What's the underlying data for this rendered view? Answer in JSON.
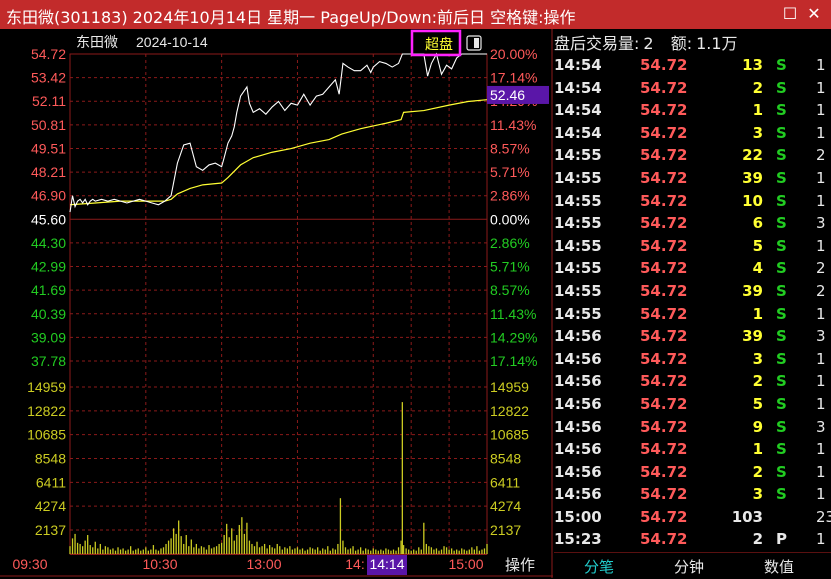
{
  "window": {
    "title": "东田微(301183) 2024年10月14日 星期一 PageUp/Down:前后日 空格键:操作",
    "restore_icon": "restore-icon",
    "close_icon": "close-icon"
  },
  "chart_header": {
    "stock_name": "东田微",
    "date": "2024-10-14",
    "super_button": "超盘",
    "toggle_icon": "panel-toggle-icon"
  },
  "price_axis": {
    "left_labels": [
      "54.72",
      "53.42",
      "52.11",
      "50.81",
      "49.51",
      "48.21",
      "46.90",
      "45.60",
      "44.30",
      "42.99",
      "41.69",
      "40.39",
      "39.09",
      "37.78"
    ],
    "right_labels": [
      "20.00%",
      "17.14%",
      "14.29%",
      "11.43%",
      "8.57%",
      "5.71%",
      "2.86%",
      "0.00%",
      "2.86%",
      "5.71%",
      "8.57%",
      "11.43%",
      "14.29%",
      "17.14%"
    ],
    "cursor_price": "52.46",
    "min": 37.78,
    "max": 54.72,
    "prev_close": 45.6
  },
  "volume_axis": {
    "labels": [
      "14959",
      "12822",
      "10685",
      "8548",
      "6411",
      "4274",
      "2137"
    ],
    "max": 14959
  },
  "time_axis": {
    "labels": [
      "09:30",
      "10:30",
      "13:00",
      "14:",
      "15:00"
    ],
    "cursor_time": "14:14",
    "operate_label": "操作"
  },
  "colors": {
    "up": "#ff5a5a",
    "down": "#22cc22",
    "price_line": "#ffffff",
    "avg_line": "#ffff33",
    "volume": "#cccc22",
    "grid": "#8b1a1a",
    "cursor_bg": "#5a16a8",
    "highlight_border": "#ff22ff"
  },
  "chart_data": {
    "type": "line",
    "x_range": [
      "09:30",
      "15:00"
    ],
    "price": [
      [
        0,
        46.0
      ],
      [
        2,
        46.9
      ],
      [
        4,
        46.3
      ],
      [
        6,
        46.6
      ],
      [
        8,
        46.7
      ],
      [
        10,
        46.5
      ],
      [
        12,
        46.7
      ],
      [
        14,
        46.4
      ],
      [
        16,
        46.6
      ],
      [
        18,
        46.7
      ],
      [
        20,
        46.6
      ],
      [
        25,
        46.7
      ],
      [
        30,
        46.6
      ],
      [
        35,
        46.7
      ],
      [
        40,
        46.6
      ],
      [
        45,
        46.5
      ],
      [
        50,
        46.6
      ],
      [
        55,
        46.7
      ],
      [
        60,
        46.6
      ],
      [
        65,
        46.5
      ],
      [
        70,
        46.4
      ],
      [
        75,
        46.6
      ],
      [
        80,
        46.9
      ],
      [
        85,
        48.7
      ],
      [
        90,
        49.7
      ],
      [
        95,
        49.8
      ],
      [
        100,
        48.5
      ],
      [
        105,
        48.3
      ],
      [
        110,
        48.6
      ],
      [
        115,
        48.7
      ],
      [
        120,
        48.5
      ],
      [
        122,
        49.0
      ],
      [
        125,
        49.8
      ],
      [
        128,
        50.2
      ],
      [
        130,
        50.7
      ],
      [
        132,
        51.5
      ],
      [
        135,
        52.4
      ],
      [
        137,
        52.6
      ],
      [
        140,
        52.9
      ],
      [
        142,
        52.0
      ],
      [
        145,
        51.5
      ],
      [
        150,
        51.7
      ],
      [
        155,
        51.4
      ],
      [
        160,
        51.8
      ],
      [
        165,
        52.1
      ],
      [
        170,
        51.6
      ],
      [
        175,
        52.0
      ],
      [
        180,
        51.9
      ],
      [
        185,
        52.5
      ],
      [
        190,
        51.9
      ],
      [
        195,
        52.4
      ],
      [
        200,
        52.5
      ],
      [
        205,
        52.9
      ],
      [
        210,
        53.3
      ],
      [
        213,
        52.5
      ],
      [
        216,
        54.2
      ],
      [
        220,
        54.0
      ],
      [
        225,
        53.8
      ],
      [
        230,
        53.8
      ],
      [
        235,
        54.1
      ],
      [
        238,
        53.7
      ],
      [
        240,
        54.0
      ],
      [
        245,
        54.3
      ],
      [
        250,
        54.2
      ],
      [
        255,
        54.0
      ],
      [
        260,
        54.2
      ],
      [
        263,
        54.72
      ],
      [
        270,
        54.72
      ],
      [
        275,
        54.72
      ],
      [
        280,
        54.72
      ],
      [
        283,
        53.5
      ],
      [
        286,
        54.2
      ],
      [
        290,
        54.72
      ],
      [
        294,
        53.6
      ],
      [
        298,
        54.1
      ],
      [
        302,
        53.9
      ],
      [
        306,
        54.5
      ],
      [
        310,
        54.72
      ],
      [
        330,
        54.72
      ]
    ],
    "average": [
      [
        0,
        46.4
      ],
      [
        20,
        46.5
      ],
      [
        40,
        46.6
      ],
      [
        60,
        46.6
      ],
      [
        75,
        46.6
      ],
      [
        80,
        46.7
      ],
      [
        85,
        47.0
      ],
      [
        95,
        47.3
      ],
      [
        105,
        47.5
      ],
      [
        120,
        47.6
      ],
      [
        125,
        47.9
      ],
      [
        135,
        48.6
      ],
      [
        145,
        49.0
      ],
      [
        160,
        49.3
      ],
      [
        175,
        49.5
      ],
      [
        190,
        49.8
      ],
      [
        205,
        50.0
      ],
      [
        215,
        50.3
      ],
      [
        230,
        50.6
      ],
      [
        250,
        50.9
      ],
      [
        262,
        51.1
      ],
      [
        264,
        51.5
      ],
      [
        280,
        51.6
      ],
      [
        300,
        51.9
      ],
      [
        315,
        52.1
      ],
      [
        330,
        52.2
      ]
    ],
    "volume": [
      [
        0,
        700
      ],
      [
        2,
        1400
      ],
      [
        4,
        1800
      ],
      [
        6,
        1000
      ],
      [
        8,
        900
      ],
      [
        10,
        700
      ],
      [
        12,
        1200
      ],
      [
        14,
        1700
      ],
      [
        16,
        800
      ],
      [
        18,
        600
      ],
      [
        20,
        1100
      ],
      [
        22,
        500
      ],
      [
        24,
        900
      ],
      [
        26,
        400
      ],
      [
        28,
        700
      ],
      [
        30,
        600
      ],
      [
        32,
        400
      ],
      [
        34,
        500
      ],
      [
        36,
        300
      ],
      [
        38,
        600
      ],
      [
        40,
        400
      ],
      [
        42,
        500
      ],
      [
        44,
        300
      ],
      [
        46,
        400
      ],
      [
        48,
        700
      ],
      [
        50,
        300
      ],
      [
        52,
        400
      ],
      [
        54,
        500
      ],
      [
        56,
        300
      ],
      [
        58,
        400
      ],
      [
        60,
        600
      ],
      [
        62,
        300
      ],
      [
        64,
        400
      ],
      [
        66,
        800
      ],
      [
        68,
        400
      ],
      [
        70,
        300
      ],
      [
        72,
        500
      ],
      [
        74,
        600
      ],
      [
        76,
        900
      ],
      [
        78,
        1200
      ],
      [
        80,
        1400
      ],
      [
        82,
        2300
      ],
      [
        84,
        1800
      ],
      [
        86,
        3000
      ],
      [
        88,
        1600
      ],
      [
        90,
        900
      ],
      [
        92,
        1700
      ],
      [
        94,
        700
      ],
      [
        96,
        1300
      ],
      [
        98,
        600
      ],
      [
        100,
        900
      ],
      [
        102,
        500
      ],
      [
        104,
        700
      ],
      [
        106,
        600
      ],
      [
        108,
        400
      ],
      [
        110,
        800
      ],
      [
        112,
        500
      ],
      [
        114,
        600
      ],
      [
        116,
        700
      ],
      [
        118,
        900
      ],
      [
        120,
        1000
      ],
      [
        122,
        1700
      ],
      [
        124,
        2700
      ],
      [
        126,
        1500
      ],
      [
        128,
        2300
      ],
      [
        130,
        1200
      ],
      [
        132,
        1700
      ],
      [
        134,
        2600
      ],
      [
        136,
        3300
      ],
      [
        138,
        1800
      ],
      [
        140,
        2800
      ],
      [
        142,
        1200
      ],
      [
        144,
        900
      ],
      [
        146,
        700
      ],
      [
        148,
        1100
      ],
      [
        150,
        600
      ],
      [
        152,
        700
      ],
      [
        154,
        900
      ],
      [
        156,
        500
      ],
      [
        158,
        800
      ],
      [
        160,
        600
      ],
      [
        162,
        500
      ],
      [
        164,
        900
      ],
      [
        166,
        700
      ],
      [
        168,
        400
      ],
      [
        170,
        600
      ],
      [
        172,
        500
      ],
      [
        174,
        700
      ],
      [
        176,
        400
      ],
      [
        178,
        500
      ],
      [
        180,
        600
      ],
      [
        182,
        400
      ],
      [
        184,
        500
      ],
      [
        186,
        300
      ],
      [
        188,
        400
      ],
      [
        190,
        600
      ],
      [
        192,
        500
      ],
      [
        194,
        400
      ],
      [
        196,
        600
      ],
      [
        198,
        300
      ],
      [
        200,
        500
      ],
      [
        202,
        400
      ],
      [
        204,
        700
      ],
      [
        206,
        300
      ],
      [
        208,
        500
      ],
      [
        210,
        400
      ],
      [
        212,
        900
      ],
      [
        214,
        5000
      ],
      [
        216,
        1200
      ],
      [
        218,
        600
      ],
      [
        220,
        400
      ],
      [
        222,
        500
      ],
      [
        224,
        700
      ],
      [
        226,
        300
      ],
      [
        228,
        400
      ],
      [
        230,
        600
      ],
      [
        232,
        300
      ],
      [
        234,
        500
      ],
      [
        236,
        400
      ],
      [
        238,
        300
      ],
      [
        240,
        500
      ],
      [
        242,
        400
      ],
      [
        244,
        300
      ],
      [
        246,
        400
      ],
      [
        248,
        300
      ],
      [
        250,
        500
      ],
      [
        252,
        400
      ],
      [
        254,
        300
      ],
      [
        256,
        400
      ],
      [
        258,
        300
      ],
      [
        260,
        600
      ],
      [
        262,
        1200
      ],
      [
        263,
        13600
      ],
      [
        264,
        800
      ],
      [
        266,
        500
      ],
      [
        268,
        400
      ],
      [
        270,
        300
      ],
      [
        272,
        400
      ],
      [
        274,
        300
      ],
      [
        276,
        600
      ],
      [
        278,
        400
      ],
      [
        280,
        2800
      ],
      [
        282,
        900
      ],
      [
        284,
        700
      ],
      [
        286,
        600
      ],
      [
        288,
        400
      ],
      [
        290,
        500
      ],
      [
        292,
        300
      ],
      [
        294,
        400
      ],
      [
        296,
        700
      ],
      [
        298,
        600
      ],
      [
        300,
        400
      ],
      [
        302,
        500
      ],
      [
        304,
        300
      ],
      [
        306,
        400
      ],
      [
        308,
        300
      ],
      [
        310,
        500
      ],
      [
        312,
        400
      ],
      [
        314,
        300
      ],
      [
        316,
        400
      ],
      [
        318,
        600
      ],
      [
        320,
        400
      ],
      [
        322,
        700
      ],
      [
        324,
        300
      ],
      [
        326,
        400
      ],
      [
        328,
        500
      ],
      [
        330,
        900
      ]
    ]
  },
  "trade_panel": {
    "header": {
      "volume_label": "盘后交易量:",
      "volume_value": "2",
      "amount_label": "额:",
      "amount_value": "1.1万"
    },
    "rows": [
      {
        "time": "14:54",
        "price": "54.72",
        "volume": "13",
        "bs": "S",
        "n": "1",
        "bs_color": "#22cc22",
        "vol_color": "#ffff33"
      },
      {
        "time": "14:54",
        "price": "54.72",
        "volume": "2",
        "bs": "S",
        "n": "1",
        "bs_color": "#22cc22",
        "vol_color": "#ffff33"
      },
      {
        "time": "14:54",
        "price": "54.72",
        "volume": "1",
        "bs": "S",
        "n": "1",
        "bs_color": "#22cc22",
        "vol_color": "#ffff33"
      },
      {
        "time": "14:54",
        "price": "54.72",
        "volume": "3",
        "bs": "S",
        "n": "1",
        "bs_color": "#22cc22",
        "vol_color": "#ffff33"
      },
      {
        "time": "14:55",
        "price": "54.72",
        "volume": "22",
        "bs": "S",
        "n": "2",
        "bs_color": "#22cc22",
        "vol_color": "#ffff33"
      },
      {
        "time": "14:55",
        "price": "54.72",
        "volume": "39",
        "bs": "S",
        "n": "1",
        "bs_color": "#22cc22",
        "vol_color": "#ffff33"
      },
      {
        "time": "14:55",
        "price": "54.72",
        "volume": "10",
        "bs": "S",
        "n": "1",
        "bs_color": "#22cc22",
        "vol_color": "#ffff33"
      },
      {
        "time": "14:55",
        "price": "54.72",
        "volume": "6",
        "bs": "S",
        "n": "3",
        "bs_color": "#22cc22",
        "vol_color": "#ffff33"
      },
      {
        "time": "14:55",
        "price": "54.72",
        "volume": "5",
        "bs": "S",
        "n": "1",
        "bs_color": "#22cc22",
        "vol_color": "#ffff33"
      },
      {
        "time": "14:55",
        "price": "54.72",
        "volume": "4",
        "bs": "S",
        "n": "2",
        "bs_color": "#22cc22",
        "vol_color": "#ffff33"
      },
      {
        "time": "14:55",
        "price": "54.72",
        "volume": "39",
        "bs": "S",
        "n": "2",
        "bs_color": "#22cc22",
        "vol_color": "#ffff33"
      },
      {
        "time": "14:55",
        "price": "54.72",
        "volume": "1",
        "bs": "S",
        "n": "1",
        "bs_color": "#22cc22",
        "vol_color": "#ffff33"
      },
      {
        "time": "14:56",
        "price": "54.72",
        "volume": "39",
        "bs": "S",
        "n": "3",
        "bs_color": "#22cc22",
        "vol_color": "#ffff33"
      },
      {
        "time": "14:56",
        "price": "54.72",
        "volume": "3",
        "bs": "S",
        "n": "1",
        "bs_color": "#22cc22",
        "vol_color": "#ffff33"
      },
      {
        "time": "14:56",
        "price": "54.72",
        "volume": "2",
        "bs": "S",
        "n": "1",
        "bs_color": "#22cc22",
        "vol_color": "#ffff33"
      },
      {
        "time": "14:56",
        "price": "54.72",
        "volume": "5",
        "bs": "S",
        "n": "1",
        "bs_color": "#22cc22",
        "vol_color": "#ffff33"
      },
      {
        "time": "14:56",
        "price": "54.72",
        "volume": "9",
        "bs": "S",
        "n": "3",
        "bs_color": "#22cc22",
        "vol_color": "#ffff33"
      },
      {
        "time": "14:56",
        "price": "54.72",
        "volume": "1",
        "bs": "S",
        "n": "1",
        "bs_color": "#22cc22",
        "vol_color": "#ffff33"
      },
      {
        "time": "14:56",
        "price": "54.72",
        "volume": "2",
        "bs": "S",
        "n": "1",
        "bs_color": "#22cc22",
        "vol_color": "#ffff33"
      },
      {
        "time": "14:56",
        "price": "54.72",
        "volume": "3",
        "bs": "S",
        "n": "1",
        "bs_color": "#22cc22",
        "vol_color": "#ffff33"
      },
      {
        "time": "15:00",
        "price": "54.72",
        "volume": "103",
        "bs": "",
        "n": "23",
        "bs_color": "#22cc22",
        "vol_color": "#e8e8e8"
      },
      {
        "time": "15:23",
        "price": "54.72",
        "volume": "2",
        "bs": "P",
        "n": "1",
        "bs_color": "#e8e8e8",
        "vol_color": "#e8e8e8"
      }
    ],
    "tabs": [
      "分笔",
      "分钟",
      "数值"
    ],
    "active_tab": 0,
    "active_tab_color": "#22cccc"
  }
}
